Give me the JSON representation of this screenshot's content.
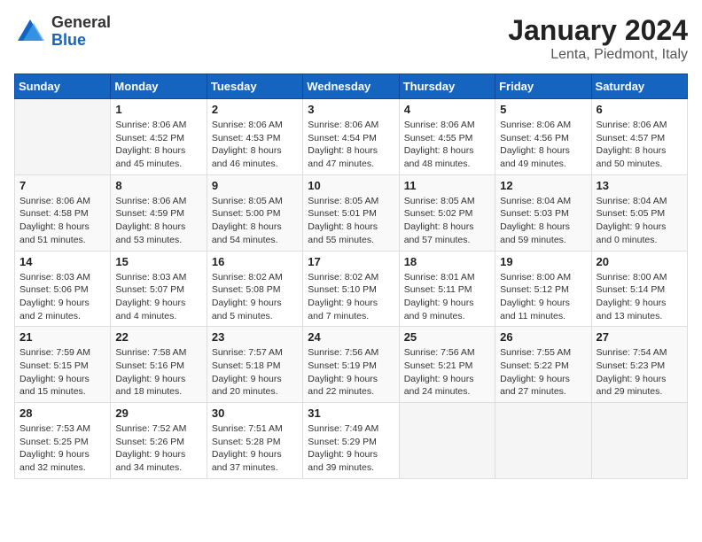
{
  "logo": {
    "general": "General",
    "blue": "Blue"
  },
  "title": "January 2024",
  "subtitle": "Lenta, Piedmont, Italy",
  "days_of_week": [
    "Sunday",
    "Monday",
    "Tuesday",
    "Wednesday",
    "Thursday",
    "Friday",
    "Saturday"
  ],
  "weeks": [
    [
      {
        "day": "",
        "sunrise": "",
        "sunset": "",
        "daylight": ""
      },
      {
        "day": "1",
        "sunrise": "Sunrise: 8:06 AM",
        "sunset": "Sunset: 4:52 PM",
        "daylight": "Daylight: 8 hours and 45 minutes."
      },
      {
        "day": "2",
        "sunrise": "Sunrise: 8:06 AM",
        "sunset": "Sunset: 4:53 PM",
        "daylight": "Daylight: 8 hours and 46 minutes."
      },
      {
        "day": "3",
        "sunrise": "Sunrise: 8:06 AM",
        "sunset": "Sunset: 4:54 PM",
        "daylight": "Daylight: 8 hours and 47 minutes."
      },
      {
        "day": "4",
        "sunrise": "Sunrise: 8:06 AM",
        "sunset": "Sunset: 4:55 PM",
        "daylight": "Daylight: 8 hours and 48 minutes."
      },
      {
        "day": "5",
        "sunrise": "Sunrise: 8:06 AM",
        "sunset": "Sunset: 4:56 PM",
        "daylight": "Daylight: 8 hours and 49 minutes."
      },
      {
        "day": "6",
        "sunrise": "Sunrise: 8:06 AM",
        "sunset": "Sunset: 4:57 PM",
        "daylight": "Daylight: 8 hours and 50 minutes."
      }
    ],
    [
      {
        "day": "7",
        "sunrise": "Sunrise: 8:06 AM",
        "sunset": "Sunset: 4:58 PM",
        "daylight": "Daylight: 8 hours and 51 minutes."
      },
      {
        "day": "8",
        "sunrise": "Sunrise: 8:06 AM",
        "sunset": "Sunset: 4:59 PM",
        "daylight": "Daylight: 8 hours and 53 minutes."
      },
      {
        "day": "9",
        "sunrise": "Sunrise: 8:05 AM",
        "sunset": "Sunset: 5:00 PM",
        "daylight": "Daylight: 8 hours and 54 minutes."
      },
      {
        "day": "10",
        "sunrise": "Sunrise: 8:05 AM",
        "sunset": "Sunset: 5:01 PM",
        "daylight": "Daylight: 8 hours and 55 minutes."
      },
      {
        "day": "11",
        "sunrise": "Sunrise: 8:05 AM",
        "sunset": "Sunset: 5:02 PM",
        "daylight": "Daylight: 8 hours and 57 minutes."
      },
      {
        "day": "12",
        "sunrise": "Sunrise: 8:04 AM",
        "sunset": "Sunset: 5:03 PM",
        "daylight": "Daylight: 8 hours and 59 minutes."
      },
      {
        "day": "13",
        "sunrise": "Sunrise: 8:04 AM",
        "sunset": "Sunset: 5:05 PM",
        "daylight": "Daylight: 9 hours and 0 minutes."
      }
    ],
    [
      {
        "day": "14",
        "sunrise": "Sunrise: 8:03 AM",
        "sunset": "Sunset: 5:06 PM",
        "daylight": "Daylight: 9 hours and 2 minutes."
      },
      {
        "day": "15",
        "sunrise": "Sunrise: 8:03 AM",
        "sunset": "Sunset: 5:07 PM",
        "daylight": "Daylight: 9 hours and 4 minutes."
      },
      {
        "day": "16",
        "sunrise": "Sunrise: 8:02 AM",
        "sunset": "Sunset: 5:08 PM",
        "daylight": "Daylight: 9 hours and 5 minutes."
      },
      {
        "day": "17",
        "sunrise": "Sunrise: 8:02 AM",
        "sunset": "Sunset: 5:10 PM",
        "daylight": "Daylight: 9 hours and 7 minutes."
      },
      {
        "day": "18",
        "sunrise": "Sunrise: 8:01 AM",
        "sunset": "Sunset: 5:11 PM",
        "daylight": "Daylight: 9 hours and 9 minutes."
      },
      {
        "day": "19",
        "sunrise": "Sunrise: 8:00 AM",
        "sunset": "Sunset: 5:12 PM",
        "daylight": "Daylight: 9 hours and 11 minutes."
      },
      {
        "day": "20",
        "sunrise": "Sunrise: 8:00 AM",
        "sunset": "Sunset: 5:14 PM",
        "daylight": "Daylight: 9 hours and 13 minutes."
      }
    ],
    [
      {
        "day": "21",
        "sunrise": "Sunrise: 7:59 AM",
        "sunset": "Sunset: 5:15 PM",
        "daylight": "Daylight: 9 hours and 15 minutes."
      },
      {
        "day": "22",
        "sunrise": "Sunrise: 7:58 AM",
        "sunset": "Sunset: 5:16 PM",
        "daylight": "Daylight: 9 hours and 18 minutes."
      },
      {
        "day": "23",
        "sunrise": "Sunrise: 7:57 AM",
        "sunset": "Sunset: 5:18 PM",
        "daylight": "Daylight: 9 hours and 20 minutes."
      },
      {
        "day": "24",
        "sunrise": "Sunrise: 7:56 AM",
        "sunset": "Sunset: 5:19 PM",
        "daylight": "Daylight: 9 hours and 22 minutes."
      },
      {
        "day": "25",
        "sunrise": "Sunrise: 7:56 AM",
        "sunset": "Sunset: 5:21 PM",
        "daylight": "Daylight: 9 hours and 24 minutes."
      },
      {
        "day": "26",
        "sunrise": "Sunrise: 7:55 AM",
        "sunset": "Sunset: 5:22 PM",
        "daylight": "Daylight: 9 hours and 27 minutes."
      },
      {
        "day": "27",
        "sunrise": "Sunrise: 7:54 AM",
        "sunset": "Sunset: 5:23 PM",
        "daylight": "Daylight: 9 hours and 29 minutes."
      }
    ],
    [
      {
        "day": "28",
        "sunrise": "Sunrise: 7:53 AM",
        "sunset": "Sunset: 5:25 PM",
        "daylight": "Daylight: 9 hours and 32 minutes."
      },
      {
        "day": "29",
        "sunrise": "Sunrise: 7:52 AM",
        "sunset": "Sunset: 5:26 PM",
        "daylight": "Daylight: 9 hours and 34 minutes."
      },
      {
        "day": "30",
        "sunrise": "Sunrise: 7:51 AM",
        "sunset": "Sunset: 5:28 PM",
        "daylight": "Daylight: 9 hours and 37 minutes."
      },
      {
        "day": "31",
        "sunrise": "Sunrise: 7:49 AM",
        "sunset": "Sunset: 5:29 PM",
        "daylight": "Daylight: 9 hours and 39 minutes."
      },
      {
        "day": "",
        "sunrise": "",
        "sunset": "",
        "daylight": ""
      },
      {
        "day": "",
        "sunrise": "",
        "sunset": "",
        "daylight": ""
      },
      {
        "day": "",
        "sunrise": "",
        "sunset": "",
        "daylight": ""
      }
    ]
  ]
}
